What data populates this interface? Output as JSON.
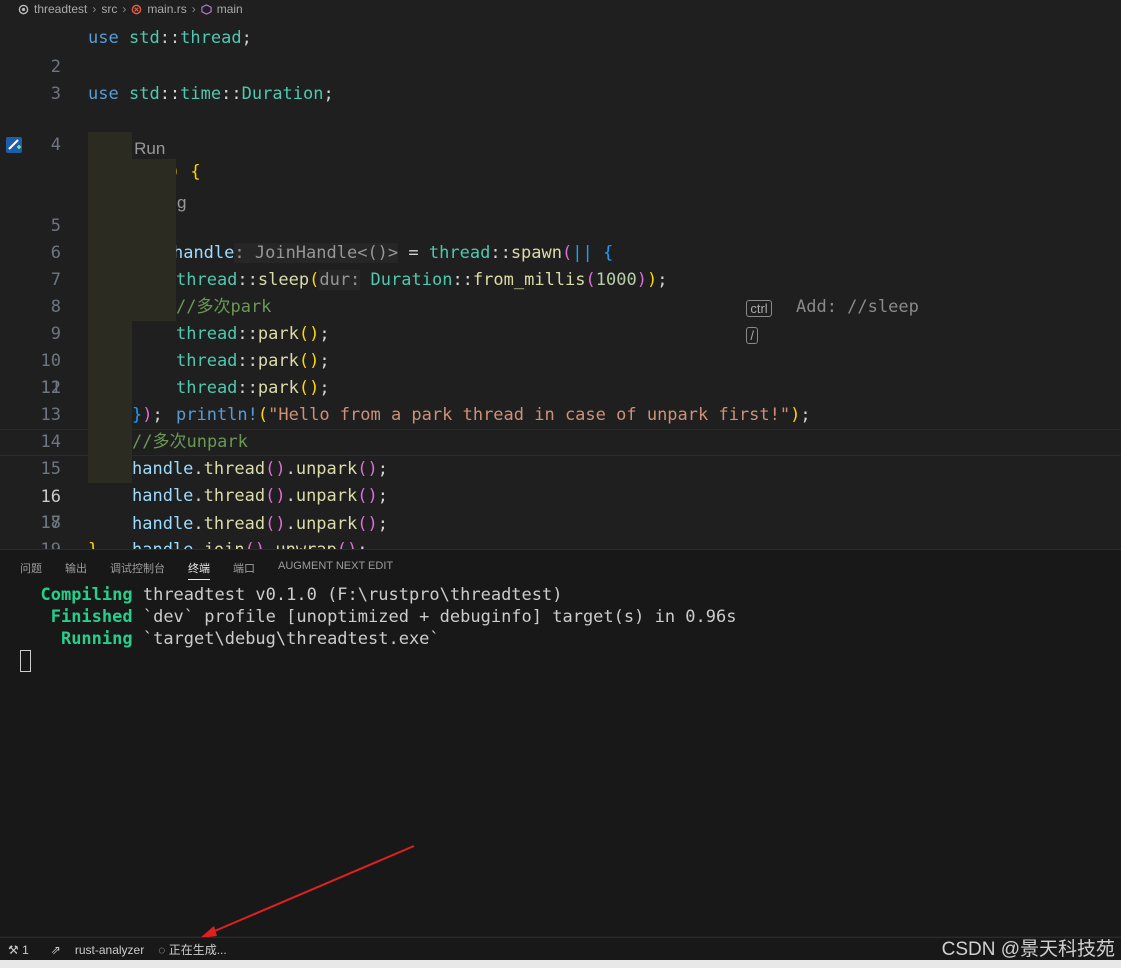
{
  "breadcrumb": {
    "items": [
      "threadtest",
      "src",
      "main.rs",
      "main"
    ]
  },
  "editor": {
    "codelens": {
      "run": "Run",
      "sep": "|",
      "debug": "Debug"
    },
    "inline_hint": {
      "ctrl": "ctrl",
      "slash": "/",
      "text": "Add: //sleep"
    },
    "lines": [
      {
        "n": "2"
      },
      {
        "n": "3"
      },
      {
        "n": "4"
      },
      {
        "n": "5"
      },
      {
        "n": "6"
      },
      {
        "n": "7"
      },
      {
        "n": "8"
      },
      {
        "n": "9"
      },
      {
        "n": "10"
      },
      {
        "n": "11"
      },
      {
        "n": "12"
      },
      {
        "n": "13"
      },
      {
        "n": "14"
      },
      {
        "n": "15"
      },
      {
        "n": "16"
      },
      {
        "n": "17"
      },
      {
        "n": "18"
      },
      {
        "n": "19"
      }
    ],
    "current_line": "16",
    "colors": {
      "background": "#1f1f1f",
      "keyword": "#569cd6",
      "function": "#dcdcaa",
      "type": "#4ec9b0",
      "string": "#ce9178",
      "comment": "#6a9955"
    }
  },
  "panel": {
    "tabs": [
      "问题",
      "输出",
      "调试控制台",
      "终端",
      "端口",
      "AUGMENT NEXT EDIT"
    ],
    "active_tab": "终端",
    "terminal": {
      "l1_label": "Compiling",
      "l1_text": " threadtest v0.1.0 (F:\\rustpro\\threadtest)",
      "l2_label": "Finished",
      "l2_text": " `dev` profile [unoptimized + debuginfo] target(s) in 0.96s",
      "l3_label": "Running",
      "l3_text": " `target\\debug\\threadtest.exe`"
    }
  },
  "statusbar": {
    "ports": "1",
    "extension": "rust-analyzer",
    "progress": "正在生成..."
  },
  "watermark": "CSDN @景天科技苑"
}
